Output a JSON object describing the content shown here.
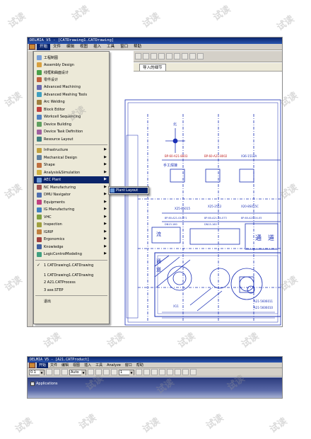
{
  "window1": {
    "title": "DELMIA V5 - [CATDrawing1.CATDrawing]",
    "menu": [
      "开始",
      "文件",
      "编辑",
      "视图",
      "插入",
      "工具",
      "窗口",
      "帮助"
    ],
    "active_tab": "导入的细节",
    "start_menu": [
      {
        "label": "工程制图",
        "icon": "drawing-icon",
        "color": "#7a9fd6",
        "submenu": false
      },
      {
        "label": "Assembly Design",
        "icon": "assembly-icon",
        "color": "#d8a040",
        "submenu": false
      },
      {
        "label": "线框和曲面设计",
        "icon": "wireframe-icon",
        "color": "#4aa04a",
        "submenu": false
      },
      {
        "label": "零件设计",
        "icon": "part-icon",
        "color": "#c06040",
        "submenu": false
      },
      {
        "label": "Advanced Machining",
        "icon": "machining-icon",
        "color": "#6a6ab0",
        "submenu": false
      },
      {
        "label": "Advanced Meshing Tools",
        "icon": "mesh-icon",
        "color": "#40a0c0",
        "submenu": false
      },
      {
        "label": "Arc Welding",
        "icon": "welding-icon",
        "color": "#a08040",
        "submenu": false
      },
      {
        "label": "Block Editor",
        "icon": "block-icon",
        "color": "#c04040",
        "submenu": false
      },
      {
        "label": "Workcell Sequencing",
        "icon": "workcell-icon",
        "color": "#5080c0",
        "submenu": false
      },
      {
        "label": "Device Building",
        "icon": "device-icon",
        "color": "#60a060",
        "submenu": false
      },
      {
        "label": "Device Task Definition",
        "icon": "task-icon",
        "color": "#a060a0",
        "submenu": false
      },
      {
        "label": "Resource Layout",
        "icon": "layout-icon",
        "color": "#408080",
        "submenu": false
      },
      {
        "label": "Infrastructure",
        "icon": "infrastructure-icon",
        "color": "#c0a040",
        "submenu": true
      },
      {
        "label": "Mechanical Design",
        "icon": "mechanical-icon",
        "color": "#6080a0",
        "submenu": true
      },
      {
        "label": "Shape",
        "icon": "shape-icon",
        "color": "#c07040",
        "submenu": true
      },
      {
        "label": "Analysis&Simulation",
        "icon": "analysis-icon",
        "color": "#d0b040",
        "submenu": true
      },
      {
        "label": "AEC Plant",
        "icon": "plant-icon",
        "color": "#6b9ad8",
        "submenu": true,
        "highlight": true
      },
      {
        "label": "NC Manufacturing",
        "icon": "nc-icon",
        "color": "#a05050",
        "submenu": true
      },
      {
        "label": "DMU Navigator",
        "icon": "dmu-icon",
        "color": "#5070b0",
        "submenu": true
      },
      {
        "label": "Equipments",
        "icon": "equipment-icon",
        "color": "#c04080",
        "submenu": true
      },
      {
        "label": "IG Manufacturing",
        "icon": "ig-icon",
        "color": "#4080c0",
        "submenu": true
      },
      {
        "label": "VHC",
        "icon": "vhc-icon",
        "color": "#80a040",
        "submenu": true
      },
      {
        "label": "Inspection",
        "icon": "inspection-icon",
        "color": "#a0a040",
        "submenu": true
      },
      {
        "label": "IGRIP",
        "icon": "igrip-icon",
        "color": "#c08040",
        "submenu": true
      },
      {
        "label": "Ergonomics",
        "icon": "ergonomics-icon",
        "color": "#a04040",
        "submenu": true
      },
      {
        "label": "Knowledge",
        "icon": "knowledge-icon",
        "color": "#4060a0",
        "submenu": true
      },
      {
        "label": "LogicControlModeling",
        "icon": "logic-icon",
        "color": "#40a080",
        "submenu": true
      }
    ],
    "recent_files": [
      {
        "label": "1 CATDrawing1.CATDrawing",
        "checked": true
      },
      {
        "label": "1 CATDrawing1.CATDrawing",
        "checked": false
      },
      {
        "label": "2 A21.CATProcess",
        "checked": false
      },
      {
        "label": "3 ase.STEP",
        "checked": false
      }
    ],
    "exit_label": "退出",
    "submenu_item": "Plant Layout",
    "drawing_labels": {
      "station": "手工焊接",
      "north": "北",
      "tags": [
        "BP-60-A21-8003",
        "BP-60-A21-8002",
        "X36-1514A",
        "X25-8S015",
        "X25-2512",
        "X20-8S015C",
        "8P-60-A21-04-071",
        "8P-60-A21-04-073",
        "8P-60-A21-04-05",
        "DN13-160",
        "DN15-160",
        "A21-5606011",
        "A21-5606010",
        "X11"
      ],
      "zone_text": [
        "通",
        "道",
        "通",
        "道",
        "流"
      ]
    }
  },
  "window2": {
    "title": "DELMIA V5 - [A21.CATProduct]",
    "menu": [
      "开始",
      "文件",
      "编辑",
      "视图",
      "插入",
      "工具",
      "Analyze",
      "窗口",
      "帮助"
    ],
    "combo_values": [
      "0.1",
      "Auto",
      "1"
    ],
    "tree_root": "Applications"
  },
  "watermark": "试读"
}
